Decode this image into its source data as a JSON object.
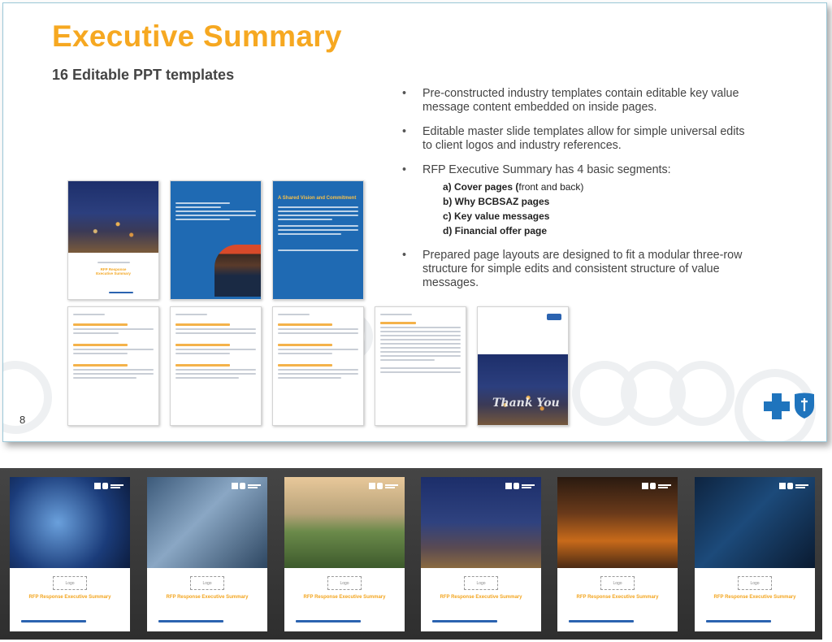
{
  "slide": {
    "title": "Executive Summary",
    "subtitle": "16 Editable PPT templates",
    "page_number": "8",
    "bullets": [
      "Pre-constructed industry templates contain editable key value message content embedded on inside pages.",
      "Editable master slide templates allow for simple universal edits to client logos and industry references.",
      "RFP Executive Summary has 4 basic segments:",
      "Prepared page layouts are designed to fit a modular three-row structure for simple edits and consistent structure of value messages."
    ],
    "segments": [
      {
        "bold": "a) Cover pages (",
        "rest": "front and back)"
      },
      {
        "bold": "b) Why BCBSAZ pages",
        "rest": ""
      },
      {
        "bold": "c) Key value messages",
        "rest": ""
      },
      {
        "bold": "d) Financial offer page",
        "rest": ""
      }
    ]
  },
  "thumbnails": {
    "cover_title": "RFP Response Executive Summary",
    "shared_vision_title": "A Shared Vision and Commitment",
    "thank_you": "Thank You"
  },
  "filmstrip": {
    "logo_placeholder": "Logo",
    "card_title": "RFP Response Executive Summary",
    "cards": [
      "lab",
      "office",
      "field",
      "mine",
      "fire",
      "control"
    ]
  },
  "colors": {
    "title_orange": "#f6a821",
    "brand_blue": "#1f6ab3",
    "text_gray": "#444444"
  }
}
